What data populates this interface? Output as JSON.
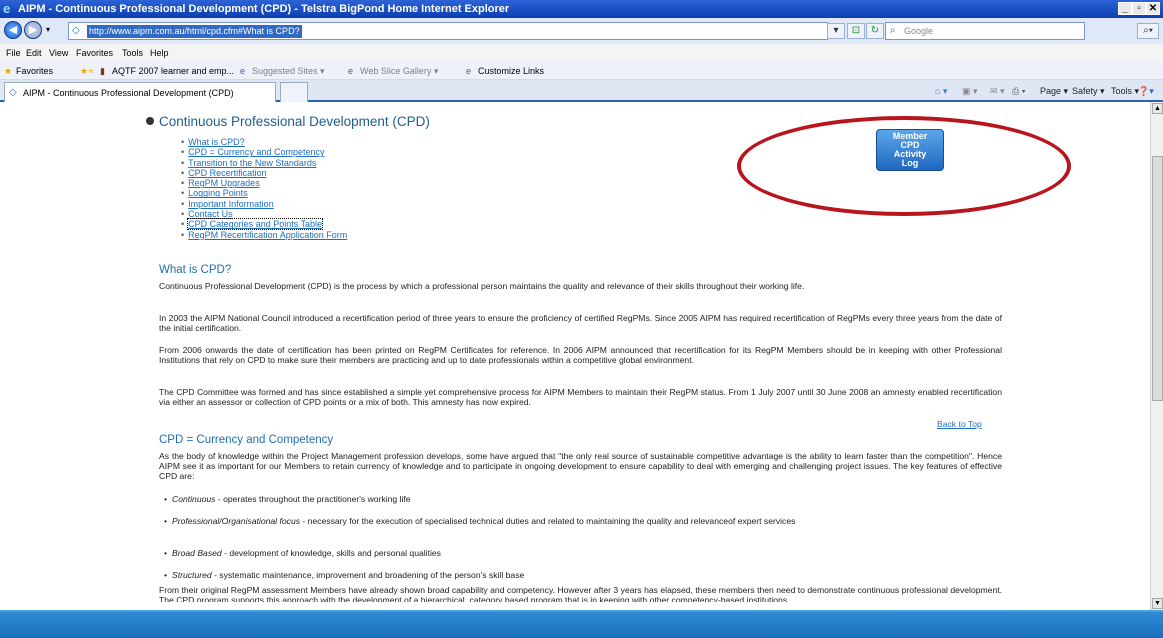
{
  "window": {
    "title": "AIPM - Continuous Professional Development (CPD) - Telstra BigPond Home Internet Explorer",
    "url": "http://www.aipm.com.au/html/cpd.cfm#What is CPD?",
    "search_placeholder": "Google"
  },
  "menu": [
    "File",
    "Edit",
    "View",
    "Favorites",
    "Tools",
    "Help"
  ],
  "favorites": {
    "label": "Favorites",
    "items": [
      "AQTF 2007 learner and emp...",
      "Suggested Sites ▾",
      "Web Slice Gallery ▾",
      "Customize Links"
    ]
  },
  "tab": {
    "label": "AIPM - Continuous Professional Development (CPD)"
  },
  "commands": [
    "Page ▾",
    "Safety ▾",
    "Tools ▾"
  ],
  "page": {
    "title": "Continuous Professional Development (CPD)",
    "toc": [
      "What is CPD?",
      "CPD = Currency and Competency",
      "Transition to the New Standards",
      "CPD Recertification",
      "RegPM Upgrades",
      "Logging Points",
      "Important Information",
      "Contact Us",
      "CPD Categories and Points Table",
      "RegPM Recertification Application Form"
    ],
    "member_button": [
      "Member",
      "CPD",
      "Activity",
      "Log"
    ],
    "section1": {
      "heading": "What is CPD?",
      "p1": "Continuous Professional Development (CPD) is the process by which a professional person maintains the quality and relevance of their skills throughout their working life.",
      "p2": "In 2003 the AIPM National Council introduced a recertification period of three years to ensure the proficiency of certified RegPMs. Since 2005 AIPM has required recertification of RegPMs every three years from the date of the initial certification.",
      "p3": "From 2006 onwards the date of certification has been printed on RegPM Certificates for reference. In 2006 AIPM announced that recertification for its RegPM Members should be in keeping with other Professional Institutions that rely on CPD to make sure their members are practicing and up to date professionals within a competitive global environment.",
      "p4": "The CPD Committee was formed and has since established a simple yet comprehensive process for AIPM Members to maintain their RegPM status. From 1 July 2007 until 30 June 2008 an amnesty enabled recertification via either an assessor or collection of CPD points or a mix of both. This amnesty has now expired."
    },
    "back_to_top": "Back to Top",
    "section2": {
      "heading": "CPD = Currency and Competency",
      "p1": "As the body of knowledge within the Project Management profession develops, some have argued that \"the only real source of sustainable competitive advantage is the ability to learn faster than the competition\". Hence AIPM see it as important for our Members to retain currency of knowledge and to participate in ongoing development to ensure capability to deal with emerging and challenging project issues. The key features of effective CPD are:",
      "bullets": [
        {
          "term": "Continuous",
          "text": " - operates throughout the practitioner's working life"
        },
        {
          "term": "Professional/Organisational focus",
          "text": " - necessary for the execution of specialised technical duties and related to maintaining the quality and relevanceof expert services"
        },
        {
          "term": "Broad Based",
          "text": " - development of knowledge, skills and personal qualities"
        },
        {
          "term": "Structured",
          "text": " - systematic maintenance, improvement and broadening of the person's skill base"
        }
      ],
      "p2": "From their original RegPM assessment Members have already shown broad capability and competency. However after 3 years has elapsed, these members then need to demonstrate continuous professional development. The CPD program supports this approach with the development of a hierarchical, category based program that is in keeping with other competency-based institutions."
    }
  },
  "colors": {
    "accent": "#1f6fb3",
    "highlight": "#b8151c",
    "band": "#1a6fbd"
  }
}
